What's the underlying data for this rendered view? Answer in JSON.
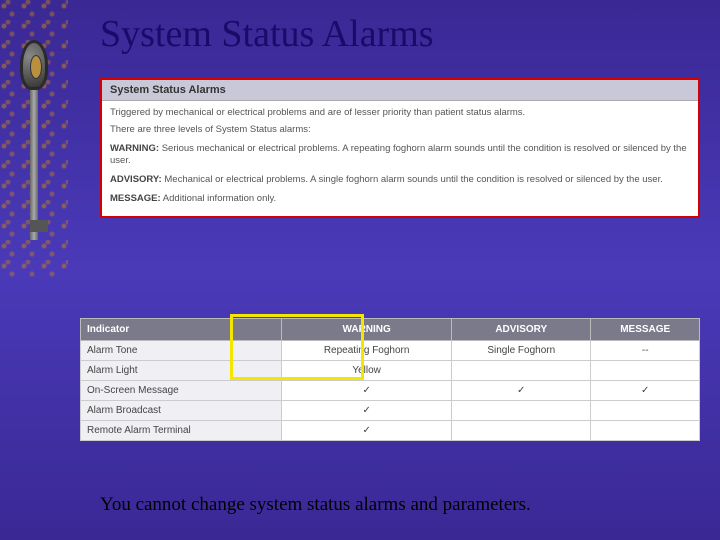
{
  "title": "System Status Alarms",
  "panel": {
    "header": "System Status Alarms",
    "intro1": "Triggered by mechanical or electrical problems and are of lesser priority than patient status alarms.",
    "intro2": "There are three levels of System Status alarms:",
    "warning_label": "WARNING:",
    "warning_text": " Serious mechanical or electrical problems. A repeating foghorn alarm sounds until the condition is resolved or silenced by the user.",
    "advisory_label": "ADVISORY:",
    "advisory_text": " Mechanical or electrical problems. A single foghorn alarm sounds until the condition is resolved or silenced by the user.",
    "message_label": "MESSAGE:",
    "message_text": " Additional information only."
  },
  "table": {
    "headers": [
      "Indicator",
      "WARNING",
      "ADVISORY",
      "MESSAGE"
    ],
    "rows": [
      {
        "label": "Alarm Tone",
        "warning": "Repeating Foghorn",
        "advisory": "Single Foghorn",
        "message": "--"
      },
      {
        "label": "Alarm Light",
        "warning": "Yellow",
        "advisory": "",
        "message": ""
      },
      {
        "label": "On-Screen Message",
        "warning": "✓",
        "advisory": "✓",
        "message": "✓"
      },
      {
        "label": "Alarm Broadcast",
        "warning": "✓",
        "advisory": "",
        "message": ""
      },
      {
        "label": "Remote Alarm Terminal",
        "warning": "✓",
        "advisory": "",
        "message": ""
      }
    ]
  },
  "footer": "You cannot change system status alarms and parameters."
}
